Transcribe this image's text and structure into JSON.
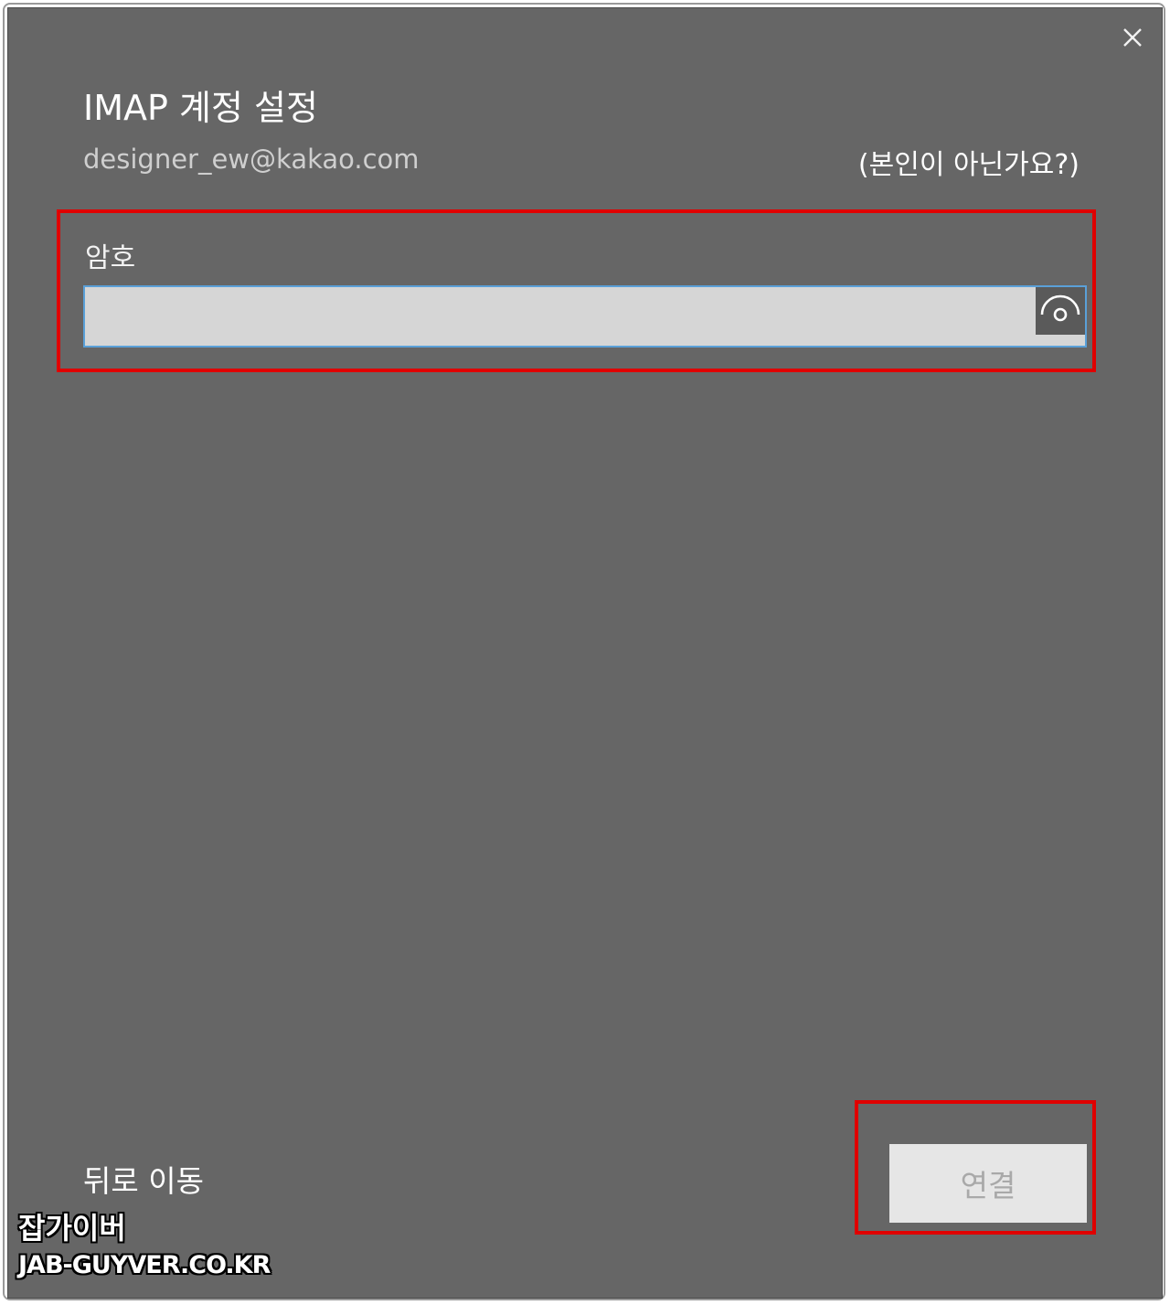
{
  "dialog": {
    "title": "IMAP 계정 설정",
    "email": "designer_ew@kakao.com",
    "not_you_link": "(본인이 아닌가요?)",
    "close_icon": "close-icon"
  },
  "password": {
    "label": "암호",
    "value": "",
    "placeholder": "",
    "reveal_icon": "eye-icon"
  },
  "footer": {
    "back_label": "뒤로 이동",
    "connect_label": "연결"
  },
  "watermark": {
    "name": "잡가이버",
    "site": "JAB-GUYVER.CO.KR"
  },
  "colors": {
    "dialog_background": "#666666",
    "highlight": "#e00000",
    "input_focus_border": "#5aa0d8"
  }
}
